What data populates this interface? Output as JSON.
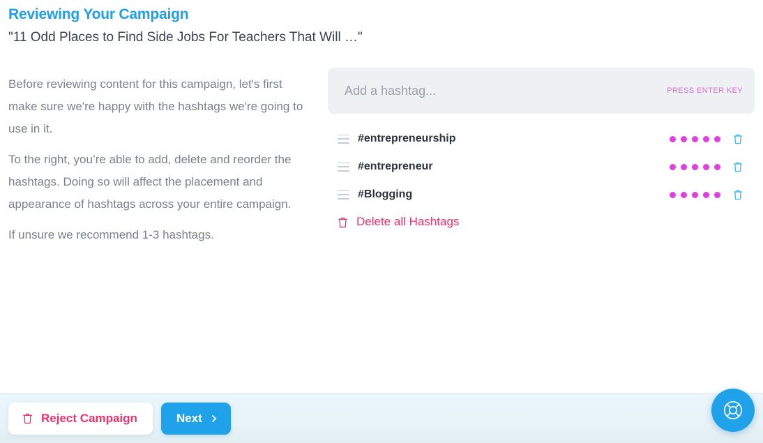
{
  "header": {
    "title": "Reviewing Your Campaign",
    "subtitle": "\"11 Odd Places to Find Side Jobs For Teachers That Will …\""
  },
  "instructions": {
    "paragraphs": [
      "Before reviewing content for this campaign, let's first make sure we're happy with the hashtags we're going to use in it.",
      "To the right, you’re able to add, delete and reorder the hashtags. Doing so will affect the placement and appearance of hashtags across your entire campaign.",
      "If unsure we recommend 1-3 hashtags."
    ]
  },
  "hashtag_input": {
    "placeholder": "Add a hashtag...",
    "value": "",
    "hint": "PRESS ENTER KEY"
  },
  "hashtags": [
    {
      "label": "#entrepreneurship",
      "strength": 5,
      "drag_icon": "drag-handle-icon",
      "delete_icon": "trash-icon"
    },
    {
      "label": "#entrepreneur",
      "strength": 5,
      "drag_icon": "drag-handle-icon",
      "delete_icon": "trash-icon"
    },
    {
      "label": "#Blogging",
      "strength": 5,
      "drag_icon": "drag-handle-icon",
      "delete_icon": "trash-icon"
    }
  ],
  "delete_all": {
    "label": "Delete all Hashtags",
    "icon": "trash-icon"
  },
  "footer": {
    "reject_label": "Reject Campaign",
    "reject_icon": "trash-icon",
    "next_label": "Next",
    "next_icon": "chevron-right-icon"
  },
  "help": {
    "icon": "lifebuoy-icon"
  },
  "colors": {
    "title_blue": "#1f9fe8",
    "accent_blue": "#1fa2ea",
    "pink": "#f0326a",
    "magenta_dot": "#e03fe0",
    "hint_orchid": "#d070d8",
    "body_text": "#7b8089",
    "subtitle_text": "#3c424b",
    "input_bg": "#eff0f3",
    "footer_bg": "#eaf6fc"
  }
}
